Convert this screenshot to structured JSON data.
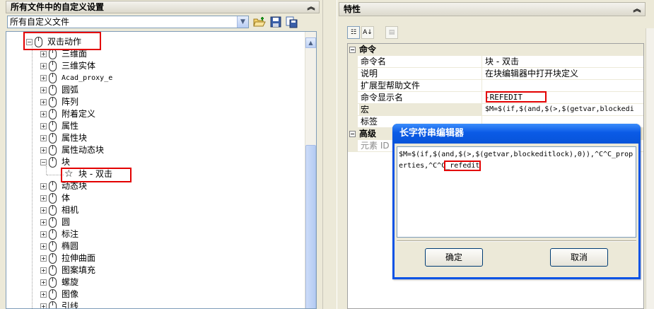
{
  "left_panel": {
    "title": "所有文件中的自定义设置",
    "file_select_value": "所有自定义文件",
    "tree": {
      "root": "双击动作",
      "items": [
        "三维面",
        "三维实体",
        "Acad_proxy_e",
        "圆弧",
        "阵列",
        "附着定义",
        "属性",
        "属性块",
        "属性动态块",
        "块"
      ],
      "block_child": "块 - 双击",
      "items_after": [
        "动态块",
        "体",
        "相机",
        "圆",
        "标注",
        "椭圆",
        "拉伸曲面",
        "图案填充",
        "螺旋",
        "图像",
        "引线"
      ]
    },
    "toolbar_icons": [
      "open-folder-icon",
      "save-icon",
      "transfer-icon"
    ]
  },
  "right_panel": {
    "title": "特性",
    "categories": {
      "command": "命令",
      "advanced": "高级"
    },
    "properties": [
      {
        "key": "命令名",
        "value": "块 - 双击"
      },
      {
        "key": "说明",
        "value": "在块编辑器中打开块定义"
      },
      {
        "key": "扩展型帮助文件",
        "value": ""
      },
      {
        "key": "命令显示名",
        "value": "-REFEDIT"
      },
      {
        "key": "宏",
        "value": "$M=$(if,$(and,$(>,$(getvar,blockedi"
      },
      {
        "key": "标签",
        "value": ""
      }
    ],
    "advanced_first_key": "元素 ID"
  },
  "dialog": {
    "title": "长字符串编辑器",
    "text_before": "$M=$(if,$(and,$(>,$(getvar,blockeditlock),0)),^C^C_properties,^C^C",
    "text_highlight": "_refedit",
    "ok_label": "确定",
    "cancel_label": "取消"
  },
  "colors": {
    "highlight": "#e30000",
    "titlebar": "#0a5ae6",
    "panel_bg": "#ece9d8"
  }
}
